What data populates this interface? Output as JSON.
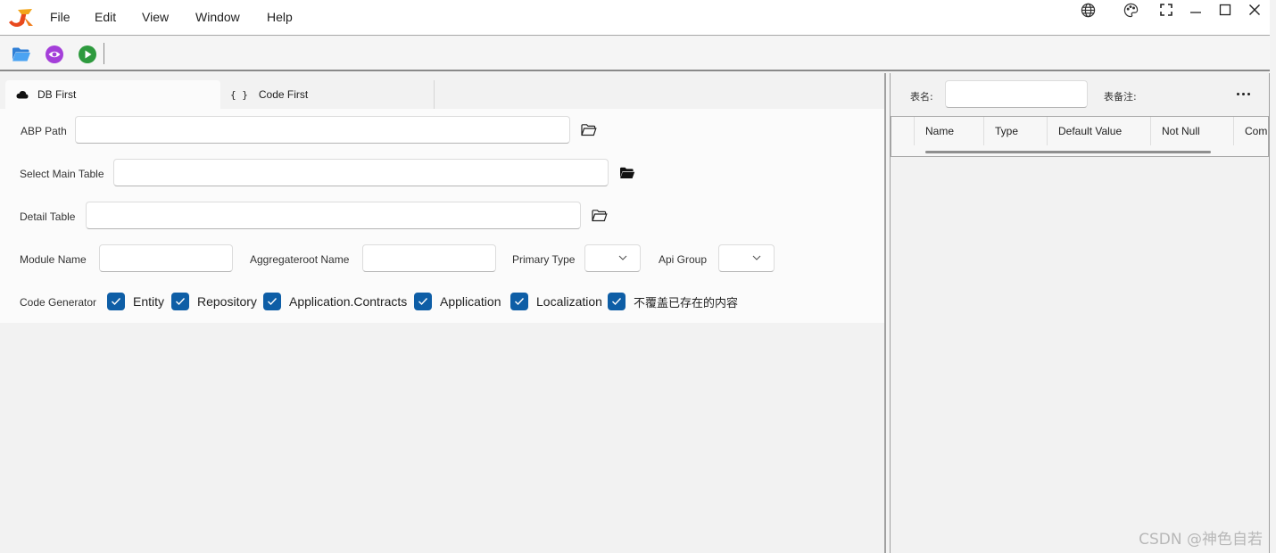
{
  "menu": {
    "items": [
      "File",
      "Edit",
      "View",
      "Window",
      "Help"
    ]
  },
  "window_controls": {
    "icons": [
      "globe-icon",
      "palette-icon",
      "fullscreen-icon",
      "minimize-icon",
      "maximize-icon",
      "close-icon"
    ]
  },
  "toolbar": {
    "icons": [
      "folder-open-icon",
      "preview-eye-icon",
      "run-play-icon"
    ],
    "colors": {
      "folder": "#3a8fe8",
      "eye": "#a43fd9",
      "play": "#2e9a3e"
    }
  },
  "tabs": [
    {
      "label": "DB First",
      "icon": "cloud-icon",
      "active": true
    },
    {
      "label": "Code First",
      "icon": "braces-icon",
      "active": false
    }
  ],
  "form": {
    "abp_path": {
      "label": "ABP Path",
      "value": ""
    },
    "main_table": {
      "label": "Select Main Table",
      "value": ""
    },
    "detail_table": {
      "label": "Detail Table",
      "value": ""
    },
    "module_name": {
      "label": "Module Name",
      "value": ""
    },
    "aggregateroot_name": {
      "label": "Aggregateroot Name",
      "value": ""
    },
    "primary_type": {
      "label": "Primary Type",
      "value": ""
    },
    "api_group": {
      "label": "Api Group",
      "value": ""
    },
    "code_generator": {
      "label": "Code Generator",
      "options": [
        {
          "label": "Entity",
          "checked": true
        },
        {
          "label": "Repository",
          "checked": true
        },
        {
          "label": "Application.Contracts",
          "checked": true
        },
        {
          "label": "Application",
          "checked": true
        },
        {
          "label": "Localization",
          "checked": true
        },
        {
          "label": "不覆盖已存在的内容",
          "checked": true
        }
      ]
    },
    "accent_color": "#0e5ea6"
  },
  "right_panel": {
    "table_name_label": "表名:",
    "table_name_value": "",
    "table_comment_label": "表备注:",
    "more_icon": "more-horizontal-icon",
    "grid_columns": [
      "Name",
      "Type",
      "Default Value",
      "Not Null",
      "Comm"
    ]
  },
  "watermark": "CSDN @神色自若"
}
